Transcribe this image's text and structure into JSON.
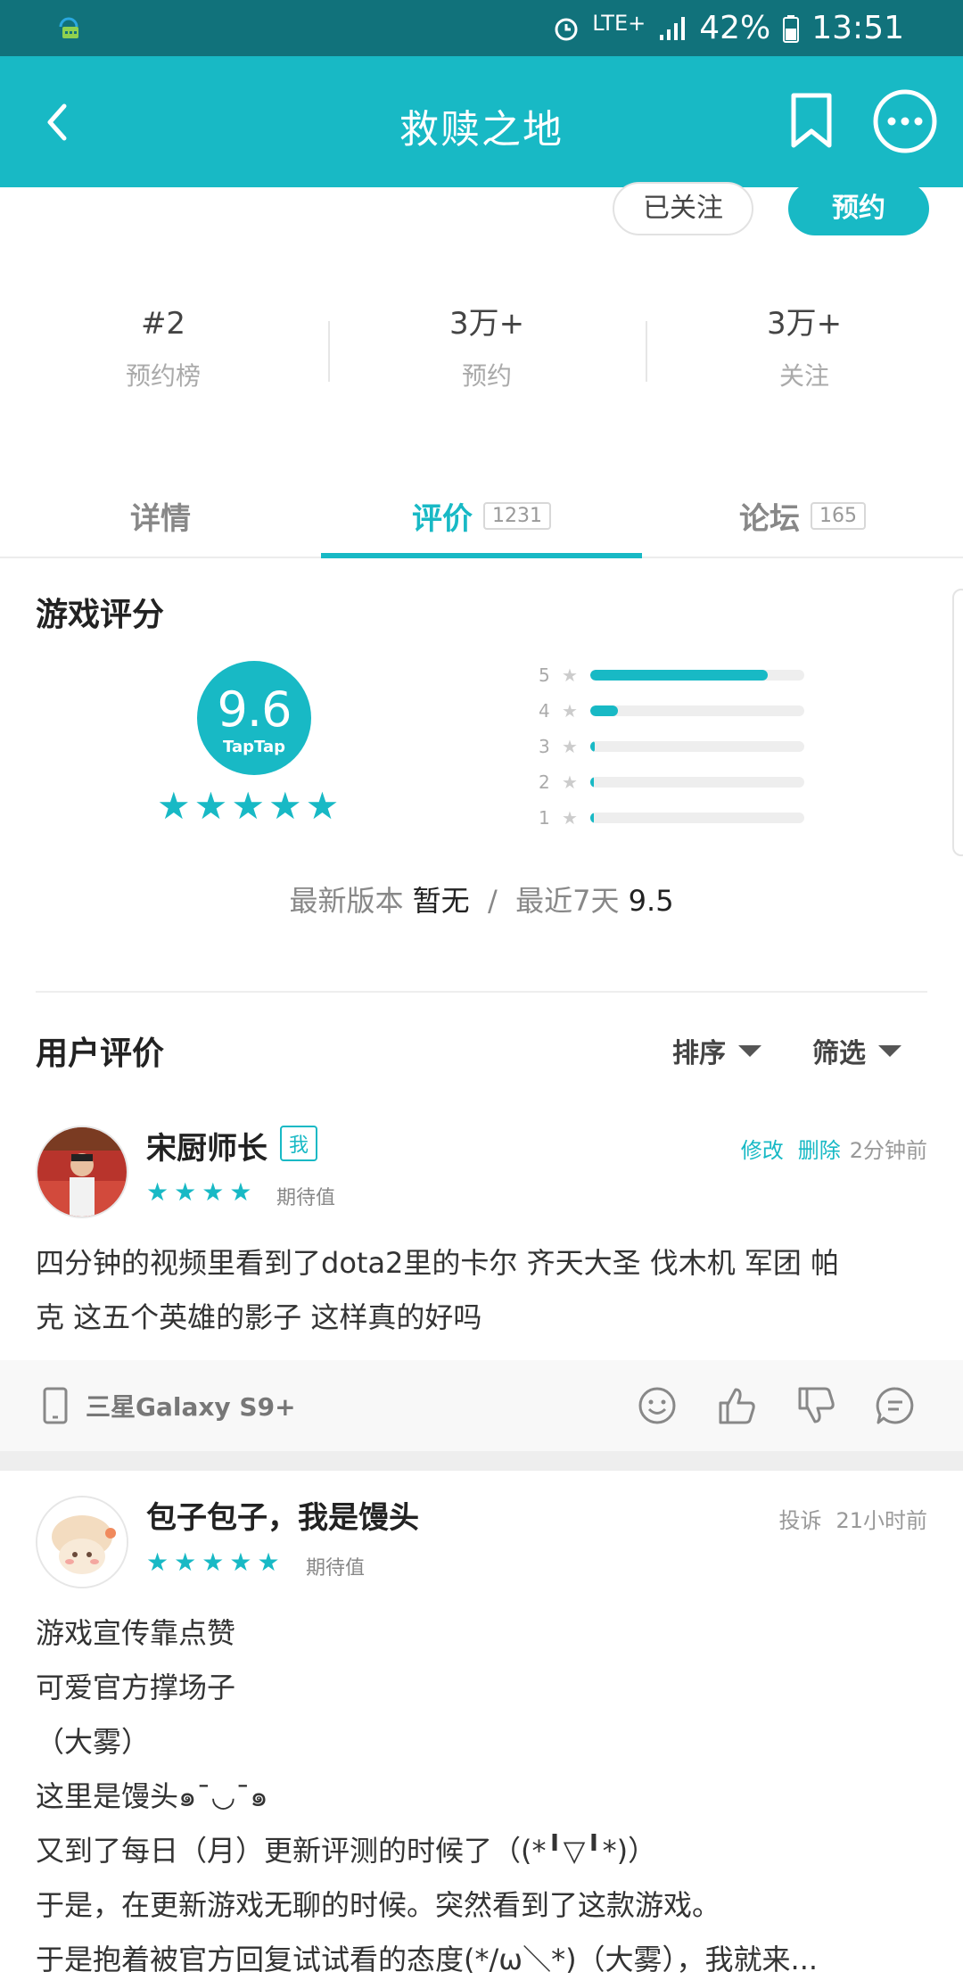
{
  "status_bar": {
    "network": "LTE+",
    "battery": "42%",
    "time": "13:51"
  },
  "app_bar": {
    "title": "救赎之地"
  },
  "actions": {
    "followed_label": "已关注",
    "reserve_label": "预约"
  },
  "stats": [
    {
      "value": "#2",
      "label": "预约榜"
    },
    {
      "value": "3万+",
      "label": "预约"
    },
    {
      "value": "3万+",
      "label": "关注"
    }
  ],
  "tabs": [
    {
      "label": "详情",
      "count": ""
    },
    {
      "label": "评价",
      "count": "1231"
    },
    {
      "label": "论坛",
      "count": "165"
    }
  ],
  "rating": {
    "section_title": "游戏评分",
    "score": "9.6",
    "brand": "TapTap",
    "distribution": [
      {
        "stars": "5",
        "fraction": 0.83
      },
      {
        "stars": "4",
        "fraction": 0.13
      },
      {
        "stars": "3",
        "fraction": 0.02
      },
      {
        "stars": "2",
        "fraction": 0.005
      },
      {
        "stars": "1",
        "fraction": 0.005
      }
    ],
    "latest_version_label": "最新版本",
    "latest_version_value": "暂无",
    "separator": "/",
    "recent_label": "最近7天",
    "recent_value": "9.5"
  },
  "reviews_header": {
    "title": "用户评价",
    "sort_label": "排序",
    "filter_label": "筛选"
  },
  "reviews": [
    {
      "name": "宋厨师长",
      "badge": "我",
      "tag": "期待值",
      "rating": 4,
      "edit_label": "修改",
      "delete_label": "删除",
      "time": "2分钟前",
      "body_lines": [
        "四分钟的视频里看到了dota2里的卡尔 齐天大圣 伐木机 军团 帕",
        "克 这五个英雄的影子 这样真的好吗"
      ],
      "device": "三星Galaxy S9+"
    },
    {
      "name": "包子包子，我是馒头",
      "tag": "期待值",
      "rating": 5,
      "report_label": "投诉",
      "time": "21小时前",
      "body_lines": [
        "游戏宣传靠点赞",
        "可爱官方撑场子",
        "（大雾）",
        "这里是馒头๑¯◡¯๑",
        "又到了每日（月）更新评测的时候了（(*╹▽╹*)）",
        "于是，在更新游戏无聊的时候。突然看到了这款游戏。",
        "于是抱着被官方回复试试看的态度(*/ω＼*)（大雾），我就来..."
      ]
    }
  ],
  "colors": {
    "accent": "#18b9c5",
    "status_bar": "#11727b"
  }
}
